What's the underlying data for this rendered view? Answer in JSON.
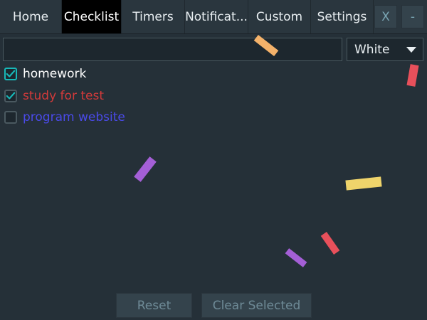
{
  "tabs": [
    {
      "label": "Home",
      "active": false
    },
    {
      "label": "Checklist",
      "active": true
    },
    {
      "label": "Timers",
      "active": false
    },
    {
      "label": "Notificat...",
      "active": false
    },
    {
      "label": "Custom",
      "active": false
    },
    {
      "label": "Settings",
      "active": false
    }
  ],
  "window": {
    "close_label": "X",
    "minimize_label": "-"
  },
  "entry": {
    "value": "",
    "placeholder": ""
  },
  "color_select": {
    "selected": "White"
  },
  "checklist": [
    {
      "label": "homework",
      "checked": true,
      "color": "#ffffff"
    },
    {
      "label": "study for test",
      "checked": true,
      "color": "#d13a3a"
    },
    {
      "label": "program website",
      "checked": false,
      "color": "#4a4ae8"
    }
  ],
  "buttons": {
    "reset": "Reset",
    "clear_selected": "Clear Selected"
  },
  "colors": {
    "accent": "#18b8b8",
    "background": "#253038",
    "confetti": [
      "#f4b26a",
      "#e8505b",
      "#a45fd6",
      "#efd46b"
    ]
  }
}
